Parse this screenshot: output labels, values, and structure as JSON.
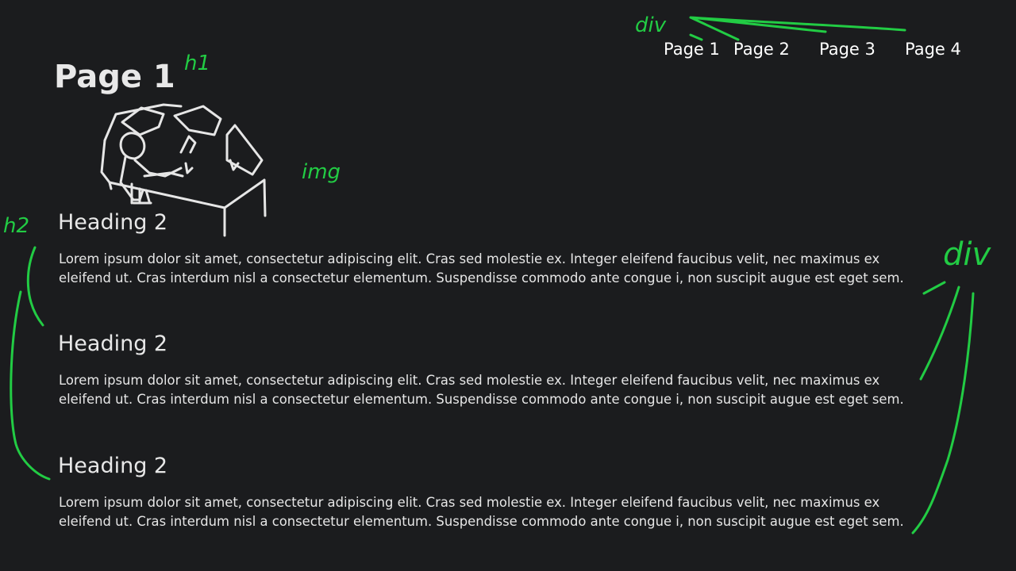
{
  "nav": {
    "items": [
      {
        "label": "Page 1"
      },
      {
        "label": "Page 2"
      },
      {
        "label": "Page 3"
      },
      {
        "label": "Page 4"
      }
    ]
  },
  "page": {
    "title": "Page 1"
  },
  "sections": [
    {
      "heading": "Heading 2",
      "text": "Lorem ipsum dolor sit amet, consectetur adipiscing elit. Cras sed molestie ex. Integer eleifend faucibus velit, nec maximus ex eleifend ut. Cras interdum nisl a consectetur elementum. Suspendisse commodo ante congue i, non suscipit augue est eget sem."
    },
    {
      "heading": "Heading 2",
      "text": "Lorem ipsum dolor sit amet, consectetur adipiscing elit. Cras sed molestie ex. Integer eleifend faucibus velit, nec maximus ex eleifend ut. Cras interdum nisl a consectetur elementum. Suspendisse commodo ante congue i, non suscipit augue est eget sem."
    },
    {
      "heading": "Heading 2",
      "text": "Lorem ipsum dolor sit amet, consectetur adipiscing elit. Cras sed molestie ex. Integer eleifend faucibus velit, nec maximus ex eleifend ut. Cras interdum nisl a consectetur elementum. Suspendisse commodo ante congue i, non suscipit augue est eget sem."
    }
  ],
  "annotations": {
    "nav_label": "div",
    "title_label": "h1",
    "image_label": "img",
    "heading_label": "h2",
    "content_label": "div"
  },
  "colors": {
    "background": "#1b1c1e",
    "text": "#e6e6e6",
    "annotation": "#22cc44"
  }
}
